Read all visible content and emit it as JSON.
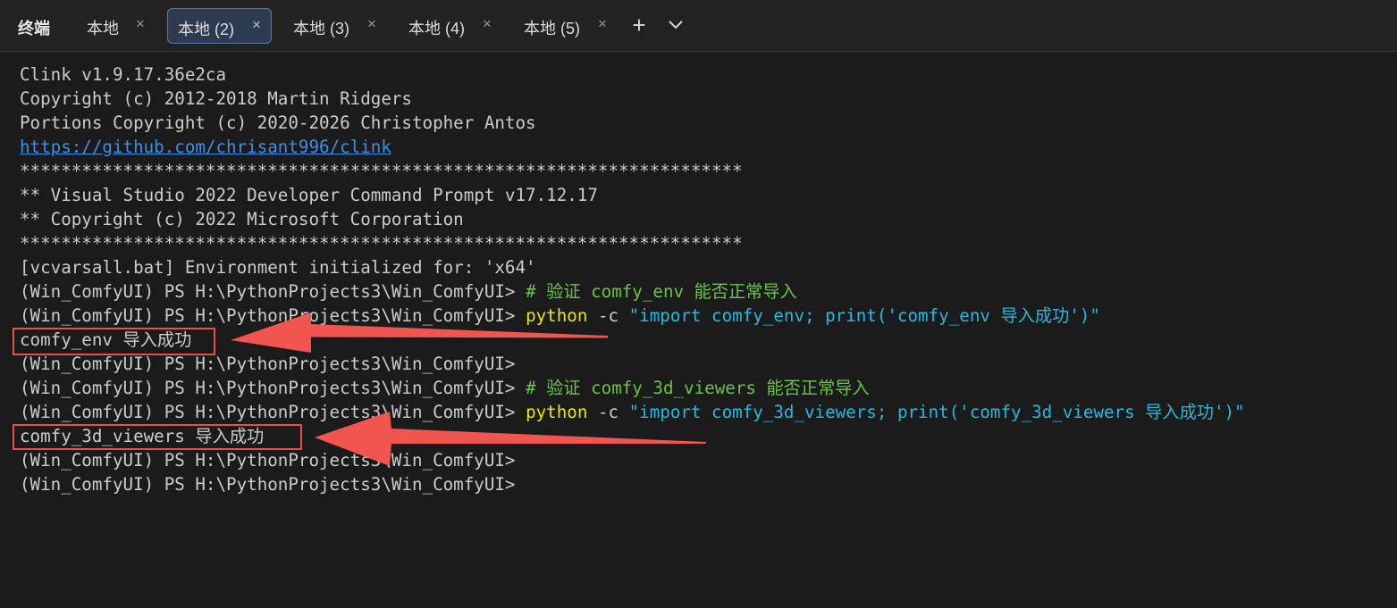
{
  "app": {
    "title": "终端"
  },
  "tabs": [
    {
      "label": "本地",
      "active": false
    },
    {
      "label": "本地 (2)",
      "active": true
    },
    {
      "label": "本地 (3)",
      "active": false
    },
    {
      "label": "本地 (4)",
      "active": false
    },
    {
      "label": "本地 (5)",
      "active": false
    }
  ],
  "toolbar": {
    "close_glyph": "×",
    "new_tab_glyph": "+",
    "dropdown_icon": "chevron-down-icon"
  },
  "terminal": {
    "prompt": "(Win_ComfyUI) PS H:\\PythonProjects3\\Win_ComfyUI>",
    "lines": [
      {
        "text": "Clink v1.9.17.36e2ca"
      },
      {
        "text": "Copyright (c) 2012-2018 Martin Ridgers"
      },
      {
        "text": "Portions Copyright (c) 2020-2026 Christopher Antos"
      },
      {
        "text": "https://github.com/chrisant996/clink"
      },
      {
        "text": "**********************************************************************"
      },
      {
        "text": "** Visual Studio 2022 Developer Command Prompt v17.12.17"
      },
      {
        "text": "** Copyright (c) 2022 Microsoft Corporation"
      },
      {
        "text": "**********************************************************************"
      },
      {
        "text": "[vcvarsall.bat] Environment initialized for: 'x64'"
      },
      {
        "comment": "# 验证 comfy_env 能否正常导入"
      },
      {
        "cmd": "python",
        "flag": "-c",
        "arg": "\"import comfy_env; print('comfy_env 导入成功')\""
      },
      {
        "text": "comfy_env 导入成功"
      },
      {
        "text": ""
      },
      {
        "comment": "# 验证 comfy_3d_viewers 能否正常导入"
      },
      {
        "cmd": "python",
        "flag": "-c",
        "arg": "\"import comfy_3d_viewers; print('comfy_3d_viewers 导入成功')\""
      },
      {
        "text": "comfy_3d_viewers 导入成功"
      },
      {
        "text": ""
      },
      {
        "text": ""
      }
    ]
  },
  "annotations": {
    "highlight_color": "#e8504a",
    "arrow_color": "#f0564f"
  },
  "colors": {
    "background": "#1b1b1c",
    "link": "#3b8eea",
    "comment": "#6cc24a",
    "command": "#e5e510",
    "string": "#29b8db"
  }
}
